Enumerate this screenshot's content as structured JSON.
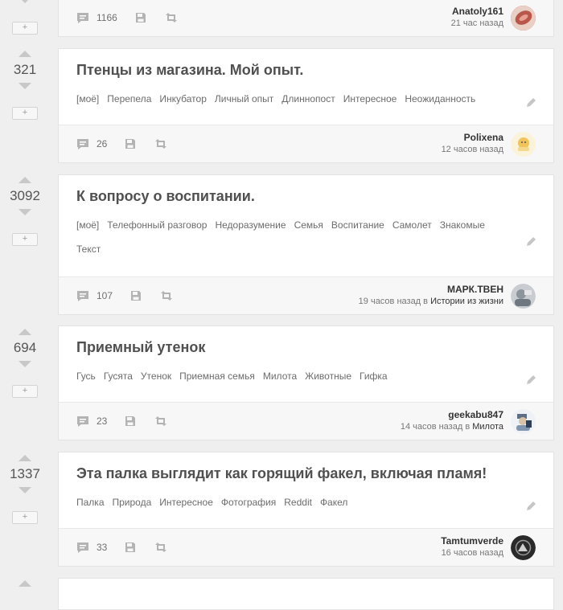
{
  "posts": [
    {
      "rating": "",
      "title": "",
      "tags": [],
      "comments": "1166",
      "author": "Anatoly161",
      "time": "21 час назад",
      "community_prefix": "",
      "community": "",
      "avatar_color": "#c9715c"
    },
    {
      "rating": "321",
      "title": "Птенцы из магазина. Мой опыт.",
      "tags": [
        "[моё]",
        "Перепела",
        "Инкубатор",
        "Личный опыт",
        "Длиннопост",
        "Интересное",
        "Неожиданность"
      ],
      "comments": "26",
      "author": "Polixena",
      "time": "12 часов назад",
      "community_prefix": "",
      "community": "",
      "avatar_color": "#f1d88f"
    },
    {
      "rating": "3092",
      "title": "К вопросу о воспитании.",
      "tags": [
        "[моё]",
        "Телефонный разговор",
        "Недоразумение",
        "Семья",
        "Воспитание",
        "Самолет",
        "Знакомые",
        "Текст"
      ],
      "comments": "107",
      "author": "МАРК.ТВЕН",
      "time": "19 часов назад",
      "community_prefix": " в ",
      "community": "Истории из жизни",
      "avatar_color": "#9aa3ad"
    },
    {
      "rating": "694",
      "title": "Приемный утенок",
      "tags": [
        "Гусь",
        "Гусята",
        "Утенок",
        "Приемная семья",
        "Милота",
        "Животные",
        "Гифка"
      ],
      "comments": "23",
      "author": "geekabu847",
      "time": "14 часов назад",
      "community_prefix": " в ",
      "community": "Милота",
      "avatar_color": "#8fa9c4"
    },
    {
      "rating": "1337",
      "title": "Эта палка выглядит как горящий факел, включая пламя!",
      "tags": [
        "Палка",
        "Природа",
        "Интересное",
        "Фотография",
        "Reddit",
        "Факел"
      ],
      "comments": "33",
      "author": "Tamtumverde",
      "time": "16 часов назад",
      "community_prefix": "",
      "community": "",
      "avatar_color": "#3a3a3a"
    }
  ],
  "plus_label": "+",
  "icons": {
    "comment": "comment-icon",
    "save": "save-icon",
    "share": "share-icon",
    "edit": "pencil-icon",
    "upvote": "upvote-arrow-icon",
    "downvote": "downvote-arrow-icon"
  }
}
